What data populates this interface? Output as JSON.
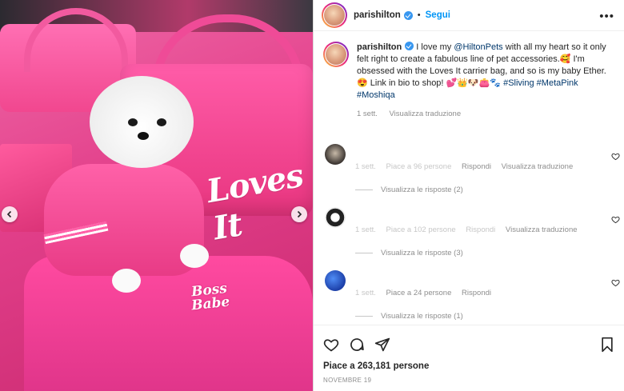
{
  "header": {
    "username": "parishilton",
    "dot": "•",
    "follow_label": "Segui",
    "more_label": "•••"
  },
  "caption": {
    "username": "parishilton",
    "text_1": "I love my ",
    "mention": "@HiltonPets",
    "text_2": " with all my heart so it only felt right to create a fabulous line of pet accessories.🥰 I'm obsessed with the Loves It carrier bag, and so is my baby Ether. 😍 Link in bio to shop! 💕👑🐶👛🐾 ",
    "tag_1": "#Sliving",
    "tag_2": "#MetaPink",
    "tag_3": "#Moshiqa",
    "time": "1 sett.",
    "translate": "Visualizza traduzione"
  },
  "media": {
    "bag_text": "Loves It",
    "patch_text": "Boss Babe"
  },
  "comments": [
    {
      "time": "1 sett.",
      "likes": "Piace a 96 persone",
      "reply": "Rispondi",
      "translate": "Visualizza traduzione",
      "view_replies": "Visualizza le risposte (2)",
      "avatar_color": "#3a3430"
    },
    {
      "time": "1 sett.",
      "likes": "Piace a 102 persone",
      "reply": "Rispondi",
      "translate": "Visualizza traduzione",
      "view_replies": "Visualizza le risposte (3)",
      "avatar_color": "#e9e9e9"
    },
    {
      "time": "1 sett.",
      "likes": "Piace a 24 persone",
      "reply": "Rispondi",
      "translate": "",
      "view_replies": "Visualizza le risposte (1)",
      "avatar_color": "#2a5bd7"
    }
  ],
  "footer": {
    "likes": "Piace a 263,181 persone",
    "date": "NOVEMBRE 19"
  },
  "colors": {
    "accent": "#0095f6",
    "secondary_text": "#8e8e8e",
    "link": "#00376b",
    "pink": "#e8357f"
  },
  "icons": [
    "chevron-left-icon",
    "chevron-right-icon",
    "heart-icon",
    "comment-icon",
    "share-icon",
    "bookmark-icon",
    "more-icon",
    "verified-icon"
  ]
}
